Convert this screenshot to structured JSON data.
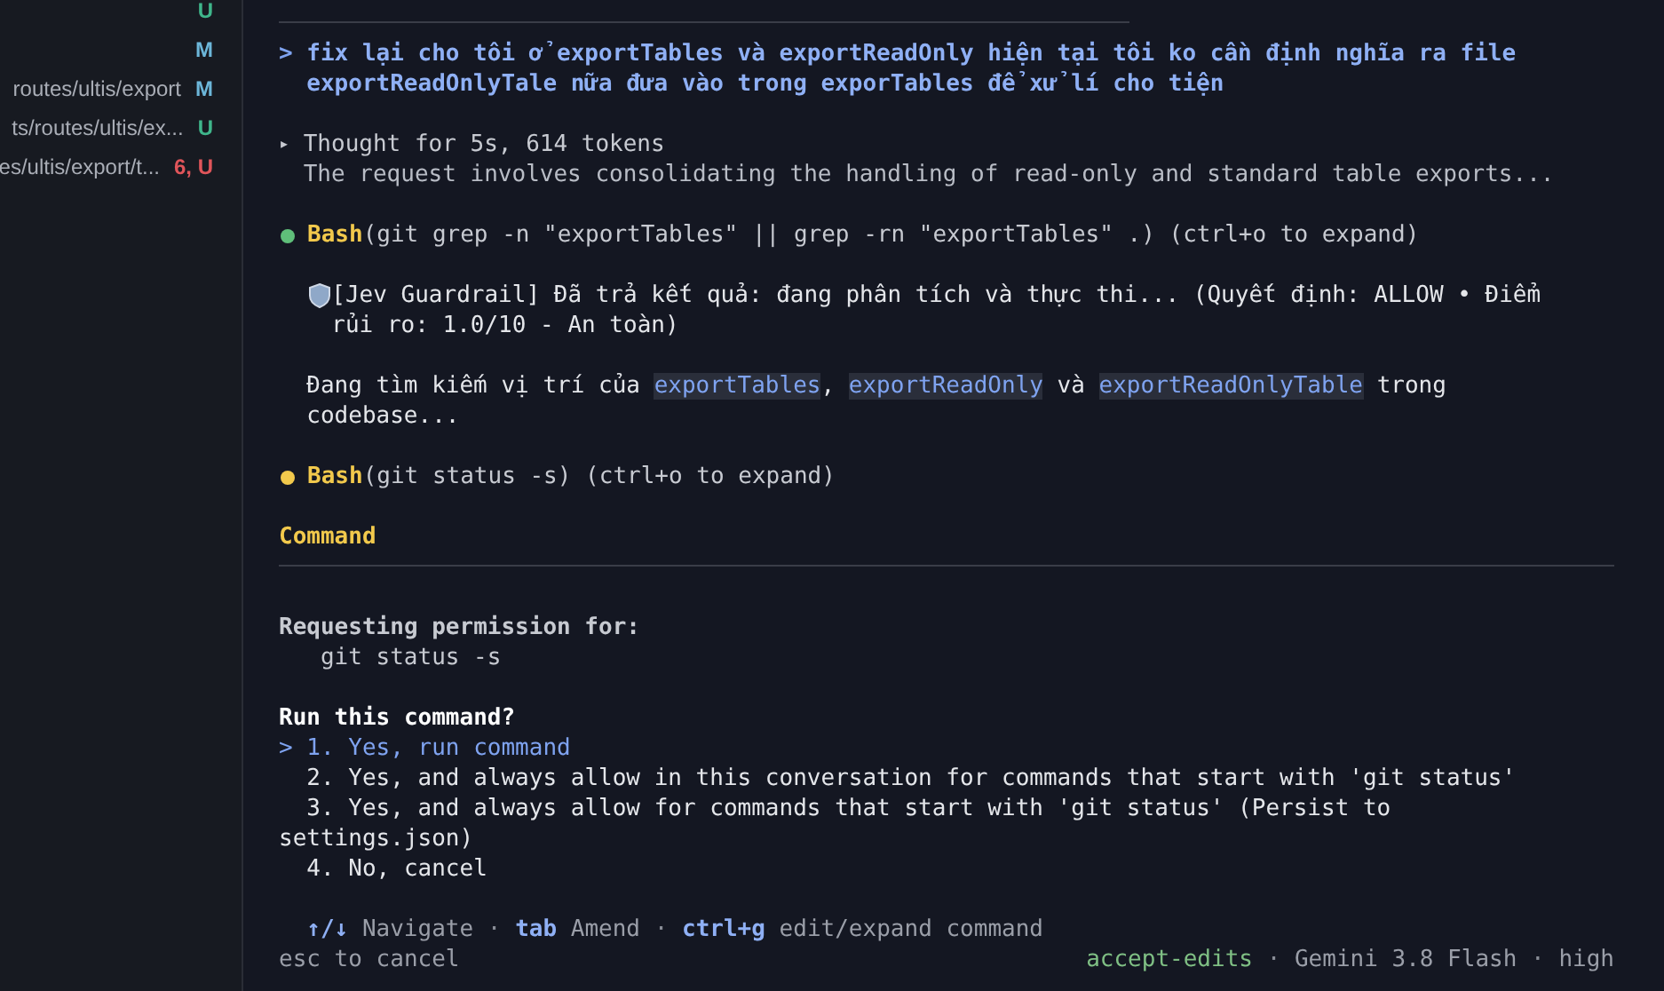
{
  "sidebar": {
    "files": [
      {
        "status": "U",
        "color": "#3fb68b"
      },
      {
        "status": "M",
        "color": "#6cb6d9"
      },
      {
        "path": "routes/ultis/export",
        "status": "M",
        "color": "#6cb6d9"
      },
      {
        "path": "ts/routes/ultis/ex...",
        "status": "U",
        "color": "#3fb68b"
      },
      {
        "path": "es/ultis/export/t...",
        "status": "6, U",
        "color": "#e0555a"
      }
    ]
  },
  "prompt": {
    "marker": ">",
    "lines": [
      "fix lại cho tôi ở exportTables và exportReadOnly hiện tại tôi ko cần định nghĩa ra file",
      "exportReadOnlyTale nữa đưa vào trong exporTables để xử lí cho tiện"
    ]
  },
  "thought": {
    "marker": "▸",
    "title": "Thought for 5s, 614 tokens",
    "summary": "The request involves consolidating the handling of read-only and standard table exports..."
  },
  "transcript": [
    {
      "kind": "tool",
      "name": "Bash",
      "args": "(git grep -n \"exportTables\" || grep -rn \"exportTables\" .)",
      "hint": "(ctrl+o to expand)",
      "color": "#5fbf7a"
    },
    {
      "kind": "guardrail",
      "text": "[Jev Guardrail] Đã trả kết quả: đang phân tích và thực thi... (Quyết định: ALLOW • Điểm rủi ro: 1.0/10 - An toàn)"
    },
    {
      "kind": "text",
      "parts": [
        {
          "kind": "plain",
          "text": "Đang tìm kiếm vị trí của "
        },
        {
          "kind": "code",
          "text": "exportTables"
        },
        {
          "kind": "plain",
          "text": ", "
        },
        {
          "kind": "code",
          "text": "exportReadOnly"
        },
        {
          "kind": "plain",
          "text": " và "
        },
        {
          "kind": "code",
          "text": "exportReadOnlyTable"
        },
        {
          "kind": "plain",
          "text": " trong codebase..."
        }
      ]
    },
    {
      "kind": "tool",
      "name": "Bash",
      "args": "(git status -s)",
      "hint": "(ctrl+o to expand)",
      "color": "#f2c94c"
    }
  ],
  "dialog": {
    "title": "Command",
    "request_label": "Requesting permission for:",
    "command": "git status -s",
    "question": "Run this command?",
    "cursor": ">",
    "options": [
      {
        "label": "1. Yes, run command",
        "selected": true
      },
      {
        "label": "2. Yes, and always allow in this conversation for commands that start with 'git status'",
        "selected": false
      },
      {
        "label": "3. Yes, and always allow for commands that start with 'git status' (Persist to settings.json)",
        "selected": false
      },
      {
        "label": "4. No, cancel",
        "selected": false
      }
    ]
  },
  "footer": {
    "hints": [
      {
        "key": "↑/↓",
        "action": "Navigate"
      },
      {
        "key": "tab",
        "action": "Amend"
      },
      {
        "key": "ctrl+g",
        "action": "edit/expand command"
      }
    ],
    "separator": "·",
    "cancel": "esc to cancel",
    "mode": "accept-edits",
    "model": "Gemini 3.8 Flash",
    "effort": "high"
  }
}
